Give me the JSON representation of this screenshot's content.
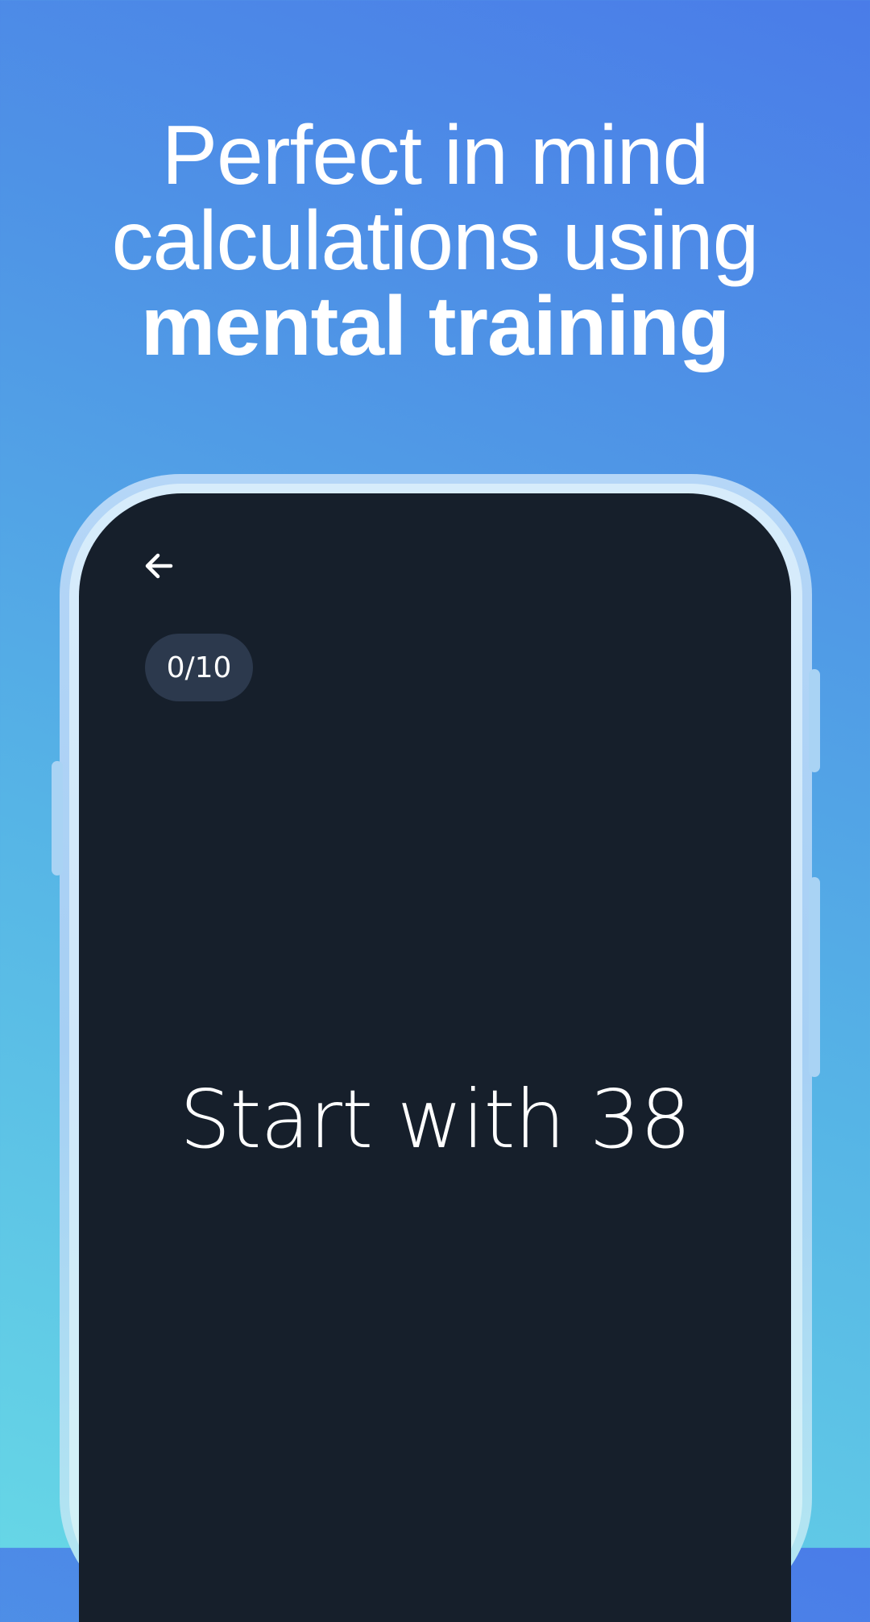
{
  "headline": {
    "line1": "Perfect in mind",
    "line2": "calculations using",
    "line3": "mental training"
  },
  "screen": {
    "back_icon": "arrow-left-icon",
    "counter": "0/10",
    "prompt": "Start with 38"
  },
  "colors": {
    "gradient_top": "#4a7ce8",
    "gradient_bottom": "#66d6e6",
    "screen_bg": "#161f2b",
    "badge_bg": "#2c394d",
    "text": "#ffffff"
  }
}
